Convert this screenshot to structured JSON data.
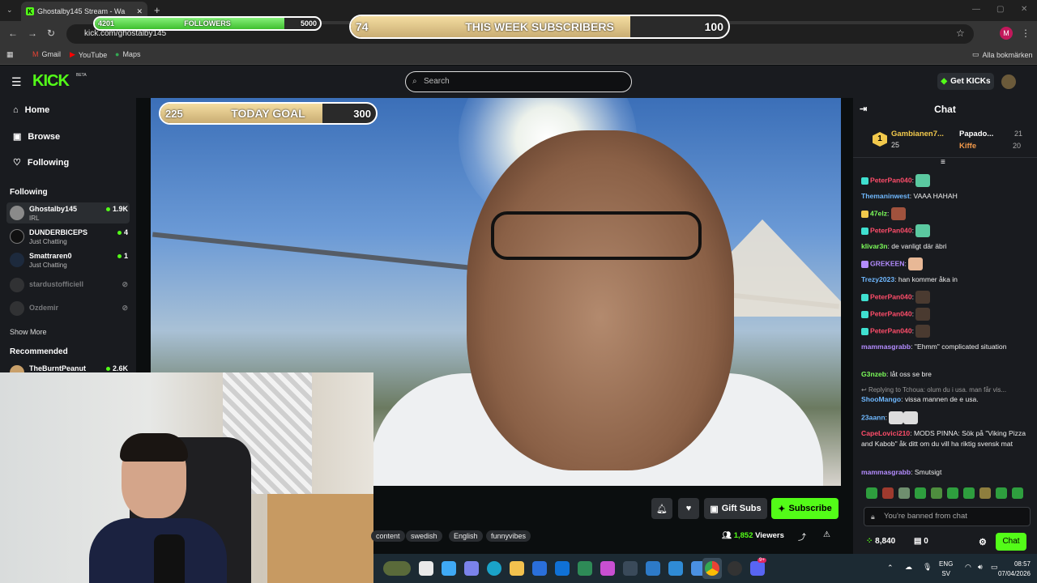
{
  "browser": {
    "tab_title": "Ghostalby145 Stream - Wa",
    "url": "kick.com/ghostalby145",
    "bookmarks": [
      "Gmail",
      "YouTube",
      "Maps"
    ],
    "all_bookmarks": "Alla bokmärken",
    "profile_initial": "M"
  },
  "overlays": {
    "followers": {
      "current": "4201",
      "label": "FOLLOWERS",
      "goal": "5000",
      "progress": 0.84
    },
    "subscribers": {
      "current": "74",
      "label": "THIS WEEK SUBSCRIBERS",
      "goal": "100",
      "progress": 0.74
    },
    "today": {
      "current": "225",
      "label": "TODAY GOAL",
      "goal": "300",
      "progress": 0.75
    }
  },
  "header": {
    "logo": "KICK",
    "logo_sup": "BETA",
    "search_placeholder": "Search",
    "get_kicks": "Get KICKs"
  },
  "sidebar": {
    "nav": [
      {
        "label": "Home",
        "icon": "home-icon"
      },
      {
        "label": "Browse",
        "icon": "browse-icon"
      },
      {
        "label": "Following",
        "icon": "heart-icon"
      }
    ],
    "following_title": "Following",
    "following": [
      {
        "name": "Ghostalby145",
        "sub": "IRL",
        "count": "1.9K",
        "live": true
      },
      {
        "name": "DUNDERBICEPS",
        "sub": "Just Chatting",
        "count": "4",
        "live": true
      },
      {
        "name": "Smattraren0",
        "sub": "Just Chatting",
        "count": "1",
        "live": true
      },
      {
        "name": "stardustofficiell",
        "sub": "",
        "count": "",
        "live": false
      },
      {
        "name": "Ozdemir",
        "sub": "",
        "count": "",
        "live": false
      }
    ],
    "show_more": "Show More",
    "recommended_title": "Recommended",
    "recommended": [
      {
        "name": "TheBurntPeanut",
        "count": "2.6K"
      }
    ]
  },
  "stream": {
    "tags": [
      "content",
      "swedish",
      "English",
      "funnyvibes"
    ],
    "gift_subs": "Gift Subs",
    "subscribe": "Subscribe",
    "viewers": "1,852",
    "viewers_label": "Viewers"
  },
  "chat": {
    "title": "Chat",
    "gifters": [
      {
        "rank": "1",
        "name": "Gambianen7...",
        "count": "25"
      },
      {
        "name": "Papado...",
        "count": "21"
      },
      {
        "name": "Kiffe",
        "count": "20"
      }
    ],
    "messages": [
      {
        "user": "PeterPan040",
        "color": "#ff4d6a",
        "text": "",
        "emote": true
      },
      {
        "user": "Themaninwest",
        "color": "#6fb8ff",
        "text": "VAAA HAHAH"
      },
      {
        "user": "47elz",
        "color": "#7cfc5a",
        "text": "",
        "emote": true
      },
      {
        "user": "PeterPan040",
        "color": "#ff4d6a",
        "text": "",
        "emote": true
      },
      {
        "user": "klivar3n",
        "color": "#7cfc5a",
        "text": "de vanligt där äbri"
      },
      {
        "user": "GREKEEN",
        "color": "#b48cff",
        "text": "",
        "emote": true
      },
      {
        "user": "Trezy2023",
        "color": "#6fb8ff",
        "text": "han kommer åka in"
      },
      {
        "user": "PeterPan040",
        "color": "#ff4d6a",
        "text": "",
        "emote": true
      },
      {
        "user": "PeterPan040",
        "color": "#ff4d6a",
        "text": "",
        "emote": true
      },
      {
        "user": "PeterPan040",
        "color": "#ff4d6a",
        "text": "",
        "emote": true
      },
      {
        "user": "mammasgrabb",
        "color": "#b48cff",
        "text": "\"Ehmm\" complicated situation"
      },
      {
        "user": "G3nzeb",
        "color": "#7cfc5a",
        "text": "låt oss se bre"
      },
      {
        "reply": "Replying to Tchoua: olum du i usa. man får vis..."
      },
      {
        "user": "ShooMango",
        "color": "#6fb8ff",
        "text": "vissa mannen de e usa."
      },
      {
        "user": "23aann",
        "color": "#6fb8ff",
        "text": "",
        "emote": true
      },
      {
        "user": "CapeLovici210",
        "color": "#ff4d6a",
        "text": "MODS PINNA: Sök på \"Viking Pizza and Kabob\" åk ditt om du vill ha riktig svensk mat"
      },
      {
        "user": "mammasgrabb",
        "color": "#b48cff",
        "text": "Smutsigt"
      }
    ],
    "banned_placeholder": "You're banned from chat",
    "points": "8,840",
    "chests": "0",
    "chat_button": "Chat"
  },
  "taskbar": {
    "lang_top": "ENG",
    "lang_bottom": "SV",
    "time": "08:57",
    "date": "07/04/2026",
    "discord_badge": "9+"
  },
  "colors": {
    "kick_green": "#53fc18",
    "bg": "#0b0e0f",
    "panel": "#191b1f"
  }
}
